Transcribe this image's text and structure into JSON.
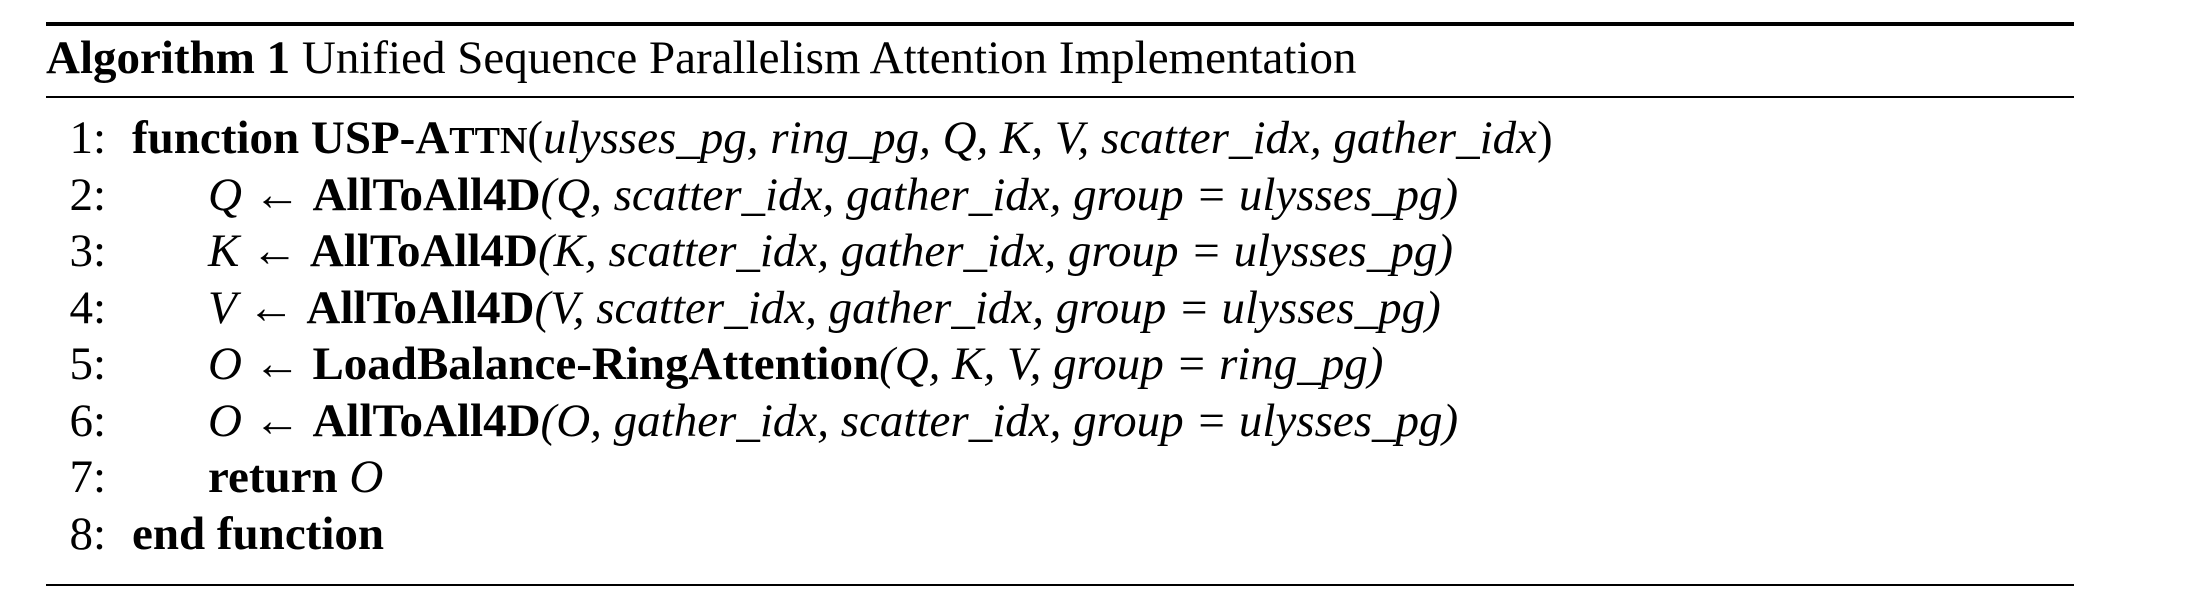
{
  "caption": {
    "label": "Algorithm 1",
    "title": "Unified Sequence Parallelism Attention Implementation"
  },
  "lines": [
    {
      "num": "1:",
      "keyword": "function",
      "fn_name_main": "USP-A",
      "fn_name_smallcaps": "TTN",
      "open": "(",
      "args": "ulysses_pg, ring_pg, Q, K, V, scatter_idx, gather_idx",
      "close": ")"
    },
    {
      "num": "2:",
      "lhs": "Q ←",
      "fn": "AllToAll4D",
      "args": "(Q, scatter_idx, gather_idx, group = ulysses_pg)"
    },
    {
      "num": "3:",
      "lhs": "K ←",
      "fn": "AllToAll4D",
      "args": "(K, scatter_idx, gather_idx, group = ulysses_pg)"
    },
    {
      "num": "4:",
      "lhs": "V ←",
      "fn": "AllToAll4D",
      "args": "(V, scatter_idx, gather_idx, group = ulysses_pg)"
    },
    {
      "num": "5:",
      "lhs": "O ←",
      "fn": "LoadBalance-RingAttention",
      "args": "(Q, K, V, group = ring_pg)"
    },
    {
      "num": "6:",
      "lhs": "O ←",
      "fn": "AllToAll4D",
      "args": "(O, gather_idx, scatter_idx, group = ulysses_pg)"
    },
    {
      "num": "7:",
      "keyword": "return",
      "value": "O"
    },
    {
      "num": "8:",
      "keyword": "end function"
    }
  ]
}
